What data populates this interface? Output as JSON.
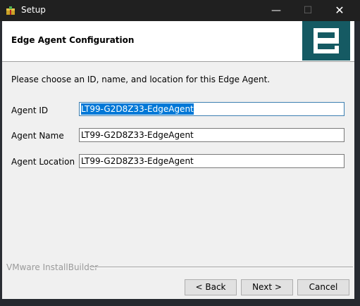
{
  "window": {
    "title": "Setup",
    "minimize_glyph": "—",
    "maximize_glyph": "☐",
    "close_glyph": "✕"
  },
  "header": {
    "title": "Edge Agent Configuration",
    "logo_icon": "edge-e-logo",
    "logo_color": "#155a63"
  },
  "intro_text": "Please choose an ID, name, and location for this Edge Agent.",
  "fields": [
    {
      "label": "Agent ID",
      "value": "LT99-G2D8Z33-EdgeAgent",
      "selected": true
    },
    {
      "label": "Agent Name",
      "value": "LT99-G2D8Z33-EdgeAgent"
    },
    {
      "label": "Agent Location",
      "value": "LT99-G2D8Z33-EdgeAgent"
    }
  ],
  "footer": {
    "builder": "VMware InstallBuilder",
    "back": "< Back",
    "next": "Next >",
    "cancel": "Cancel"
  },
  "colors": {
    "selection": "#0078d7",
    "titlebar": "#202020",
    "dialog_bg": "#f0f0f0"
  }
}
